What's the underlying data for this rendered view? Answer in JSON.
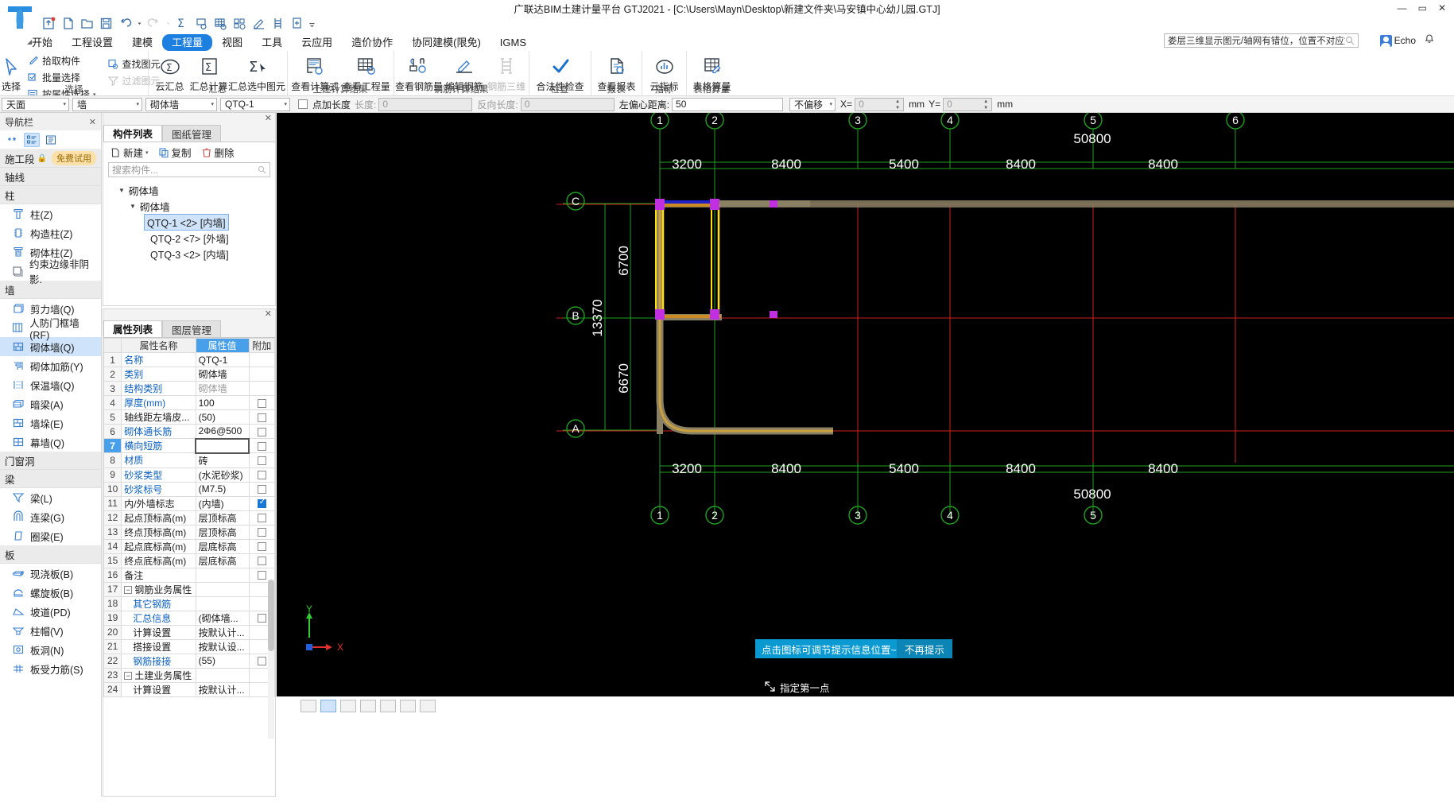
{
  "window": {
    "title": "广联达BIM土建计量平台 GTJ2021 - [C:\\Users\\Mayn\\Desktop\\新建文件夹\\马安镇中心幼儿园.GTJ]",
    "minimize": "—",
    "maximize": "▭",
    "close": "✕"
  },
  "search": {
    "value": "娄层三维显示图元/轴网有错位，位置不对应如何处理？",
    "icon": "search-icon"
  },
  "account": {
    "name": "Echo",
    "avatar": "user-avatar",
    "bell": "bell-icon"
  },
  "quick_access": [
    "upload-icon",
    "new-file-icon",
    "open-folder-icon",
    "save-icon",
    "undo-icon",
    "redo-icon",
    "sum-icon",
    "report-query-icon",
    "table-query-icon",
    "rebar-query-icon",
    "edit-rebar-icon",
    "ladder-icon",
    "add-page-icon",
    "more-icon"
  ],
  "menu": {
    "items": [
      {
        "label": "开始",
        "active": false
      },
      {
        "label": "工程设置",
        "active": false
      },
      {
        "label": "建模",
        "active": false
      },
      {
        "label": "工程量",
        "active": true
      },
      {
        "label": "视图",
        "active": false
      },
      {
        "label": "工具",
        "active": false
      },
      {
        "label": "云应用",
        "active": false
      },
      {
        "label": "造价协作",
        "active": false
      },
      {
        "label": "协同建模(限免)",
        "active": false
      },
      {
        "label": "IGMS",
        "active": false
      }
    ]
  },
  "ribbon": {
    "groups": [
      {
        "label": "选择",
        "big": [
          {
            "label": "选择",
            "icon": "cursor-icon",
            "disabled": false
          }
        ],
        "small": [
          {
            "label": "拾取构件",
            "icon": "pick-component-icon",
            "disabled": false
          },
          {
            "label": "批量选择",
            "icon": "batch-select-icon",
            "disabled": false
          },
          {
            "label": "按属性选择",
            "icon": "select-by-attr-icon",
            "disabled": false,
            "caret": true
          }
        ],
        "small2": [
          {
            "label": "查找图元",
            "icon": "find-element-icon",
            "disabled": false
          },
          {
            "label": "过滤图元",
            "icon": "filter-element-icon",
            "disabled": true
          }
        ]
      },
      {
        "label": "汇总",
        "big": [
          {
            "label": "云汇总",
            "icon": "cloud-sum-icon",
            "disabled": false
          },
          {
            "label": "汇总计算",
            "icon": "sum-calc-icon",
            "disabled": false
          },
          {
            "label": "汇总选中图元",
            "icon": "sum-selected-icon",
            "disabled": false
          }
        ]
      },
      {
        "label": "土建计算结果",
        "big": [
          {
            "label": "查看计算式",
            "icon": "view-formula-icon",
            "disabled": false
          },
          {
            "label": "查看工程量",
            "icon": "view-quantity-icon",
            "disabled": false
          }
        ]
      },
      {
        "label": "钢筋计算结果",
        "big": [
          {
            "label": "查看钢筋量",
            "icon": "view-rebar-icon",
            "disabled": false
          },
          {
            "label": "编辑钢筋",
            "icon": "edit-rebar-icon",
            "disabled": false
          },
          {
            "label": "钢筋三维",
            "icon": "rebar-3d-icon",
            "disabled": true
          }
        ]
      },
      {
        "label": "检查",
        "big": [
          {
            "label": "合法性检查",
            "icon": "check-icon",
            "disabled": false
          }
        ]
      },
      {
        "label": "报表",
        "big": [
          {
            "label": "查看报表",
            "icon": "view-report-icon",
            "disabled": false
          }
        ]
      },
      {
        "label": "指标",
        "big": [
          {
            "label": "云指标",
            "icon": "cloud-index-icon",
            "disabled": false
          }
        ]
      },
      {
        "label": "表格算量",
        "big": [
          {
            "label": "表格算量",
            "icon": "table-calc-icon",
            "disabled": false
          }
        ]
      }
    ]
  },
  "options_bar": {
    "floor": "天面",
    "category": "墙",
    "type": "砌体墙",
    "member": "QTQ-1",
    "point_add_len_label": "点加长度",
    "point_add_len_checked": false,
    "length_label": "长度:",
    "length_value": "0",
    "reverse_len_label": "反向长度:",
    "reverse_len_value": "0",
    "left_offset_label": "左偏心距离:",
    "left_offset_value": "50",
    "offset_mode": "不偏移",
    "x_label": "X=",
    "x_value": "0",
    "x_unit": "mm",
    "y_label": "Y=",
    "y_value": "0",
    "y_unit": "mm"
  },
  "left_nav": {
    "header": "导航栏",
    "close": "✕",
    "tools": [
      "add-star-icon",
      "list-view-icon",
      "detail-view-icon"
    ],
    "sections": [
      {
        "title": "施工段",
        "lock": "🔒",
        "badge": "免费试用",
        "items": []
      },
      {
        "title": "轴线",
        "items": []
      },
      {
        "title": "柱",
        "items": [
          {
            "label": "柱(Z)",
            "icon": "column-icon",
            "selected": false
          },
          {
            "label": "构造柱(Z)",
            "icon": "structural-column-icon",
            "selected": false
          },
          {
            "label": "砌体柱(Z)",
            "icon": "masonry-column-icon",
            "selected": false
          },
          {
            "label": "约束边缘非阴影.",
            "icon": "edge-nonshadow-icon",
            "selected": false
          }
        ]
      },
      {
        "title": "墙",
        "items": [
          {
            "label": "剪力墙(Q)",
            "icon": "shear-wall-icon",
            "selected": false
          },
          {
            "label": "人防门框墙(RF)",
            "icon": "door-frame-wall-icon",
            "selected": false
          },
          {
            "label": "砌体墙(Q)",
            "icon": "masonry-wall-icon",
            "selected": true
          },
          {
            "label": "砌体加筋(Y)",
            "icon": "masonry-rebar-icon",
            "selected": false
          },
          {
            "label": "保温墙(Q)",
            "icon": "insulation-wall-icon",
            "selected": false
          },
          {
            "label": "暗梁(A)",
            "icon": "hidden-beam-icon",
            "selected": false
          },
          {
            "label": "墙垛(E)",
            "icon": "wall-pier-icon",
            "selected": false
          },
          {
            "label": "幕墙(Q)",
            "icon": "curtain-wall-icon",
            "selected": false
          }
        ]
      },
      {
        "title": "门窗洞",
        "items": []
      },
      {
        "title": "梁",
        "items": [
          {
            "label": "梁(L)",
            "icon": "beam-icon",
            "selected": false
          },
          {
            "label": "连梁(G)",
            "icon": "coupling-beam-icon",
            "selected": false
          },
          {
            "label": "圈梁(E)",
            "icon": "ring-beam-icon",
            "selected": false
          }
        ]
      },
      {
        "title": "板",
        "items": [
          {
            "label": "现浇板(B)",
            "icon": "cast-slab-icon",
            "selected": false
          },
          {
            "label": "螺旋板(B)",
            "icon": "spiral-slab-icon",
            "selected": false
          },
          {
            "label": "坡道(PD)",
            "icon": "ramp-icon",
            "selected": false
          },
          {
            "label": "柱帽(V)",
            "icon": "column-cap-icon",
            "selected": false
          },
          {
            "label": "板洞(N)",
            "icon": "slab-hole-icon",
            "selected": false
          },
          {
            "label": "板受力筋(S)",
            "icon": "slab-rebar-icon",
            "selected": false
          }
        ]
      }
    ]
  },
  "component_panel": {
    "close": "✕",
    "tabs": [
      {
        "label": "构件列表",
        "active": true
      },
      {
        "label": "图纸管理",
        "active": false
      }
    ],
    "toolbar": [
      {
        "label": "新建",
        "icon": "new-icon",
        "caret": true
      },
      {
        "label": "复制",
        "icon": "copy-icon",
        "caret": false
      },
      {
        "label": "删除",
        "icon": "delete-icon",
        "caret": false
      }
    ],
    "search_placeholder": "搜索构件...",
    "tree": {
      "root": "砌体墙",
      "child": "砌体墙",
      "leaves": [
        {
          "label": "QTQ-1 <2> [内墙]",
          "selected": true
        },
        {
          "label": "QTQ-2 <7> [外墙]",
          "selected": false
        },
        {
          "label": "QTQ-3 <2> [内墙]",
          "selected": false
        }
      ]
    }
  },
  "property_panel": {
    "close": "✕",
    "tabs": [
      {
        "label": "属性列表",
        "active": true
      },
      {
        "label": "图层管理",
        "active": false
      }
    ],
    "headers": [
      "",
      "属性名称",
      "属性值",
      "附加"
    ],
    "rows": [
      {
        "n": "1",
        "name": "名称",
        "value": "QTQ-1",
        "link": true,
        "grey": false,
        "attach": "none",
        "selected": false,
        "indent": 0
      },
      {
        "n": "2",
        "name": "类别",
        "value": "砌体墙",
        "link": true,
        "grey": false,
        "attach": "none",
        "selected": false,
        "indent": 0
      },
      {
        "n": "3",
        "name": "结构类别",
        "value": "砌体墙",
        "link": true,
        "grey": true,
        "attach": "none",
        "selected": false,
        "indent": 0
      },
      {
        "n": "4",
        "name": "厚度(mm)",
        "value": "100",
        "link": true,
        "grey": false,
        "attach": "unchecked",
        "selected": false,
        "indent": 0
      },
      {
        "n": "5",
        "name": "轴线距左墙皮...",
        "value": "(50)",
        "link": false,
        "grey": false,
        "attach": "unchecked",
        "selected": false,
        "indent": 0
      },
      {
        "n": "6",
        "name": "砌体通长筋",
        "value": "2Ф6@500",
        "link": true,
        "grey": false,
        "attach": "unchecked",
        "selected": false,
        "indent": 0
      },
      {
        "n": "7",
        "name": "横向短筋",
        "value": "",
        "link": true,
        "grey": false,
        "attach": "unchecked",
        "selected": true,
        "indent": 0
      },
      {
        "n": "8",
        "name": "材质",
        "value": "砖",
        "link": true,
        "grey": false,
        "attach": "unchecked",
        "selected": false,
        "indent": 0
      },
      {
        "n": "9",
        "name": "砂浆类型",
        "value": "(水泥砂浆)",
        "link": true,
        "grey": false,
        "attach": "unchecked",
        "selected": false,
        "indent": 0
      },
      {
        "n": "10",
        "name": "砂浆标号",
        "value": "(M7.5)",
        "link": true,
        "grey": false,
        "attach": "unchecked",
        "selected": false,
        "indent": 0
      },
      {
        "n": "11",
        "name": "内/外墙标志",
        "value": "(内墙)",
        "link": false,
        "grey": false,
        "attach": "checked",
        "selected": false,
        "indent": 0
      },
      {
        "n": "12",
        "name": "起点顶标高(m)",
        "value": "层顶标高",
        "link": false,
        "grey": false,
        "attach": "unchecked",
        "selected": false,
        "indent": 0
      },
      {
        "n": "13",
        "name": "终点顶标高(m)",
        "value": "层顶标高",
        "link": false,
        "grey": false,
        "attach": "unchecked",
        "selected": false,
        "indent": 0
      },
      {
        "n": "14",
        "name": "起点底标高(m)",
        "value": "层底标高",
        "link": false,
        "grey": false,
        "attach": "unchecked",
        "selected": false,
        "indent": 0
      },
      {
        "n": "15",
        "name": "终点底标高(m)",
        "value": "层底标高",
        "link": false,
        "grey": false,
        "attach": "unchecked",
        "selected": false,
        "indent": 0
      },
      {
        "n": "16",
        "name": "备注",
        "value": "",
        "link": false,
        "grey": false,
        "attach": "unchecked",
        "selected": false,
        "indent": 0
      },
      {
        "n": "17",
        "name": "钢筋业务属性",
        "value": "",
        "link": false,
        "grey": false,
        "attach": "none",
        "selected": false,
        "indent": 0,
        "group": true
      },
      {
        "n": "18",
        "name": "其它钢筋",
        "value": "",
        "link": true,
        "grey": false,
        "attach": "none",
        "selected": false,
        "indent": 1
      },
      {
        "n": "19",
        "name": "汇总信息",
        "value": "(砌体墙...",
        "link": true,
        "grey": false,
        "attach": "unchecked",
        "selected": false,
        "indent": 1
      },
      {
        "n": "20",
        "name": "计算设置",
        "value": "按默认计...",
        "link": false,
        "grey": false,
        "attach": "none",
        "selected": false,
        "indent": 1
      },
      {
        "n": "21",
        "name": "搭接设置",
        "value": "按默认设...",
        "link": false,
        "grey": false,
        "attach": "none",
        "selected": false,
        "indent": 1
      },
      {
        "n": "22",
        "name": "钢筋接接",
        "value": "(55)",
        "link": true,
        "grey": false,
        "attach": "unchecked",
        "selected": false,
        "indent": 1
      },
      {
        "n": "23",
        "name": "土建业务属性",
        "value": "",
        "link": false,
        "grey": false,
        "attach": "none",
        "selected": false,
        "indent": 0,
        "group": true
      },
      {
        "n": "24",
        "name": "计算设置",
        "value": "按默认计...",
        "link": false,
        "grey": false,
        "attach": "none",
        "selected": false,
        "indent": 1
      }
    ]
  },
  "canvas": {
    "grid_labels_top": [
      "1",
      "2",
      "3",
      "4",
      "5",
      "6"
    ],
    "grid_labels_bottom": [
      "1",
      "2",
      "3",
      "4",
      "5"
    ],
    "axis_labels_left": [
      "C",
      "B",
      "A"
    ],
    "dims_top": [
      "3200",
      "8400",
      "5400",
      "8400",
      "8400"
    ],
    "dims_bottom": [
      "3200",
      "8400",
      "5400",
      "8400",
      "8400"
    ],
    "total_top": "50800",
    "total_bottom": "50800",
    "dims_vertical": [
      "6700",
      "6670"
    ],
    "total_vertical": "13370",
    "compass": {
      "x": "X",
      "y": "Y"
    }
  },
  "tooltip": {
    "message": "点击图标可调节提示信息位置~",
    "dismiss": "不再提示"
  },
  "status": {
    "cursor_icon": "crosshair-icon",
    "prompt": "指定第一点"
  }
}
